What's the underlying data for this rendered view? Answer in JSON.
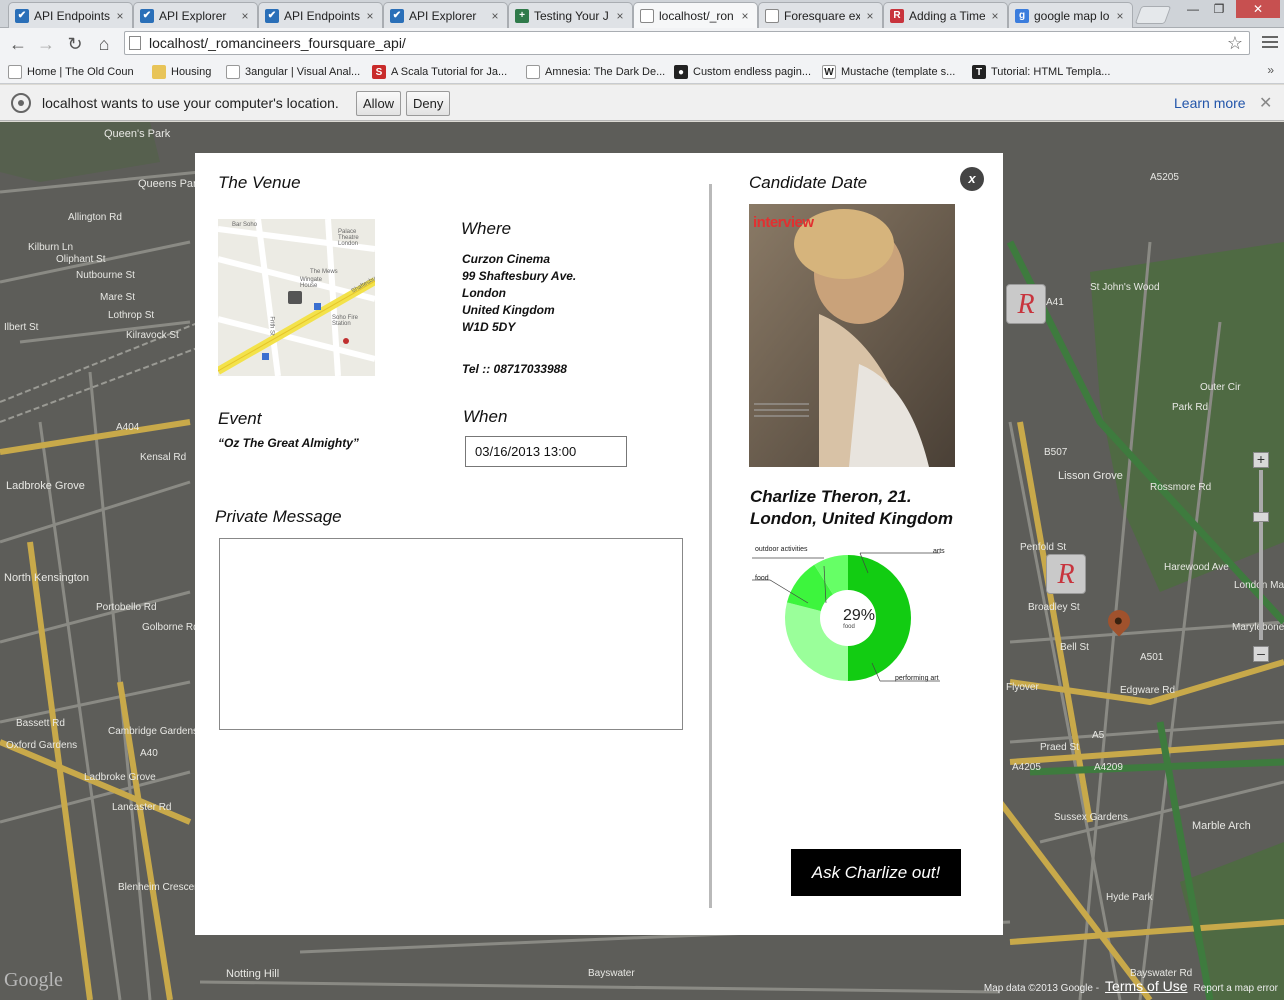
{
  "browser": {
    "tabs": [
      {
        "label": "API Endpoints",
        "icon": "check-icon",
        "color": "#2a6fb8"
      },
      {
        "label": "API Explorer",
        "icon": "check-icon",
        "color": "#2a6fb8"
      },
      {
        "label": "API Endpoints",
        "icon": "check-icon",
        "color": "#2a6fb8"
      },
      {
        "label": "API Explorer",
        "icon": "check-icon",
        "color": "#2a6fb8"
      },
      {
        "label": "Testing Your J",
        "icon": "plus-icon",
        "color": "#2f7a4a"
      },
      {
        "label": "localhost/_ron",
        "icon": "page-icon",
        "color": "#ffffff",
        "active": true
      },
      {
        "label": "Foresquare ex",
        "icon": "page-icon",
        "color": "#ffffff"
      },
      {
        "label": "Adding a Time",
        "icon": "r-icon",
        "color": "#c8343d"
      },
      {
        "label": "google map lo",
        "icon": "google-icon",
        "color": "#3b7ddd"
      }
    ],
    "url": "localhost/_romancineers_foursquare_api/",
    "bookmarks": [
      {
        "label": "Home | The Old Coun",
        "icon": "page-icon"
      },
      {
        "label": "Housing",
        "icon": "folder-icon"
      },
      {
        "label": "3angular | Visual Anal...",
        "icon": "page-icon"
      },
      {
        "label": "A Scala Tutorial for Ja...",
        "icon": "scala-icon"
      },
      {
        "label": "Amnesia: The Dark De...",
        "icon": "page-icon"
      },
      {
        "label": "Custom endless pagin...",
        "icon": "github-icon"
      },
      {
        "label": "Mustache (template s...",
        "icon": "wikipedia-icon"
      },
      {
        "label": "Tutorial: HTML Templa...",
        "icon": "t-icon"
      }
    ],
    "infobar": {
      "message": "localhost wants to use your computer's location.",
      "allow": "Allow",
      "deny": "Deny",
      "learn_more": "Learn more"
    }
  },
  "map": {
    "labels": [
      "Queen's Park",
      "Queens Park",
      "Kilburn Ln",
      "Allington Rd",
      "Oliphant St",
      "Nutbourne St",
      "Mare St",
      "Lothrop St",
      "Ilbert St",
      "Kilravock St",
      "A404",
      "Kensal Rd",
      "Ladbroke Grove",
      "North Kensington",
      "Portobello Rd",
      "Golborne Rd",
      "Bassett Rd",
      "Oxford Gardens",
      "Cambridge Gardens",
      "A40",
      "Ladbroke Grove",
      "Lancaster Rd",
      "Blenheim Crescent",
      "Notting Hill",
      "Bayswater",
      "St John's Wood",
      "Lisson Grove",
      "Marylebone",
      "London Marylebone",
      "Edgware Rd",
      "Marble Arch",
      "A41",
      "A5205",
      "B507",
      "A501",
      "A5",
      "A4209",
      "A4205",
      "Sussex Gardens",
      "Praed St",
      "Outer Cir",
      "Park Rd",
      "Rossmore Rd",
      "Harewood Ave",
      "Penfold St",
      "Broadley St",
      "Bell St",
      "Flyover",
      "Bayswater Rd",
      "Hyde Park"
    ],
    "footer": {
      "data": "Map data ©2013 Google -",
      "terms": "Terms of Use",
      "report": "Report a map error"
    },
    "logo": "Google"
  },
  "modal": {
    "venue_title": "The Venue",
    "where_title": "Where",
    "address": [
      "Curzon Cinema",
      "99 Shaftesbury Ave.",
      "London",
      "United Kingdom",
      "W1D 5DY"
    ],
    "tel": "Tel :: 08717033988",
    "event_title": "Event",
    "event_name": "“Oz The Great Almighty”",
    "when_title": "When",
    "when_value": "03/16/2013 13:00",
    "message_title": "Private Message",
    "message_value": "",
    "candidate_title": "Candidate Date",
    "photo_caption": "interview",
    "candidate_name": "Charlize Theron, 21.",
    "candidate_location": "London, United Kingdom",
    "close": "x",
    "ask_button": "Ask Charlize out!",
    "venue_map_labels": [
      "Bar Soho",
      "Palace Theatre London",
      "The Mews",
      "Wingate House",
      "Soho Fire Station",
      "Shaftesbury",
      "Frith St"
    ]
  },
  "chart_data": {
    "type": "pie",
    "donut": true,
    "center_value": "29%",
    "center_label": "food",
    "categories": [
      "performing art",
      "food",
      "outdoor activities",
      "arts"
    ],
    "values": [
      50,
      29,
      12,
      9
    ],
    "colors": [
      "#12cc12",
      "#9aff9a",
      "#3df53d",
      "#66ff66"
    ]
  }
}
